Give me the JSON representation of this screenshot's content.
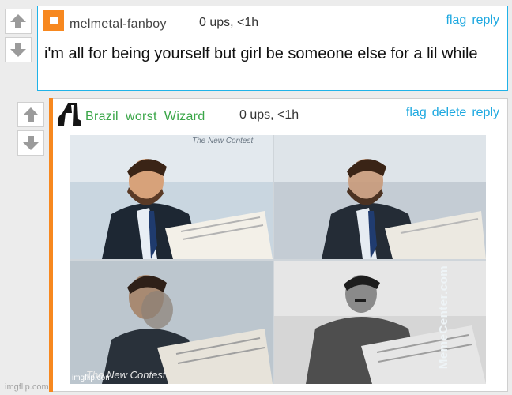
{
  "comments": [
    {
      "username": "melmetal-fanboy",
      "stats": "0 ups, <1h",
      "actions": [
        "flag",
        "reply"
      ],
      "text": "i'm all for being yourself but girl be someone else for a lil while",
      "avatar_icon": "orange-square-avatar-icon"
    },
    {
      "username": "Brazil_worst_Wizard",
      "stats": "0 ups, <1h",
      "actions": [
        "flag",
        "delete",
        "reply"
      ],
      "avatar_icon": "black-silhouette-avatar-icon",
      "image": {
        "watermark_top": "The New Contest",
        "watermark_bottom": "The New Contest",
        "side_watermark": "MemeCenter.com",
        "footer": "imgflip.com"
      }
    }
  ],
  "vote_icons": [
    "upvote-arrow-icon",
    "downvote-arrow-icon"
  ],
  "site_footer": "imgflip.com",
  "colors": {
    "accent_blue": "#20b2e8",
    "link_blue": "#1da8e0",
    "orange": "#f7881f",
    "username_green": "#3aa648"
  }
}
